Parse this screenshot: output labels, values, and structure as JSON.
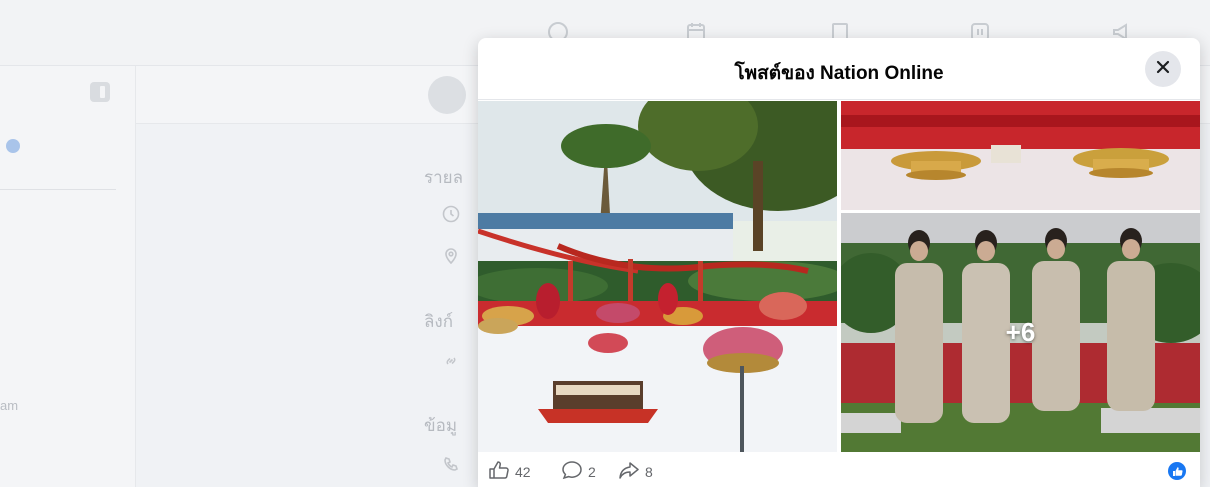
{
  "modal": {
    "title": "โพสต์ของ Nation Online",
    "more_photos_label": "+6"
  },
  "stats": {
    "likes": "42",
    "comments": "2",
    "shares": "8"
  },
  "background": {
    "about_heading_1": "รายล",
    "about_heading_2": "ลิงก์",
    "about_heading_3": "ข้อมู",
    "left_fragment": "am"
  },
  "icons": {
    "close": "close-icon",
    "like": "thumbs-up-icon",
    "comment": "comment-bubble-icon",
    "share": "share-arrow-icon",
    "reaction": "like-reaction-icon"
  },
  "colors": {
    "accent": "#1877f2",
    "stat_text": "#65676b",
    "title_text": "#050505"
  }
}
